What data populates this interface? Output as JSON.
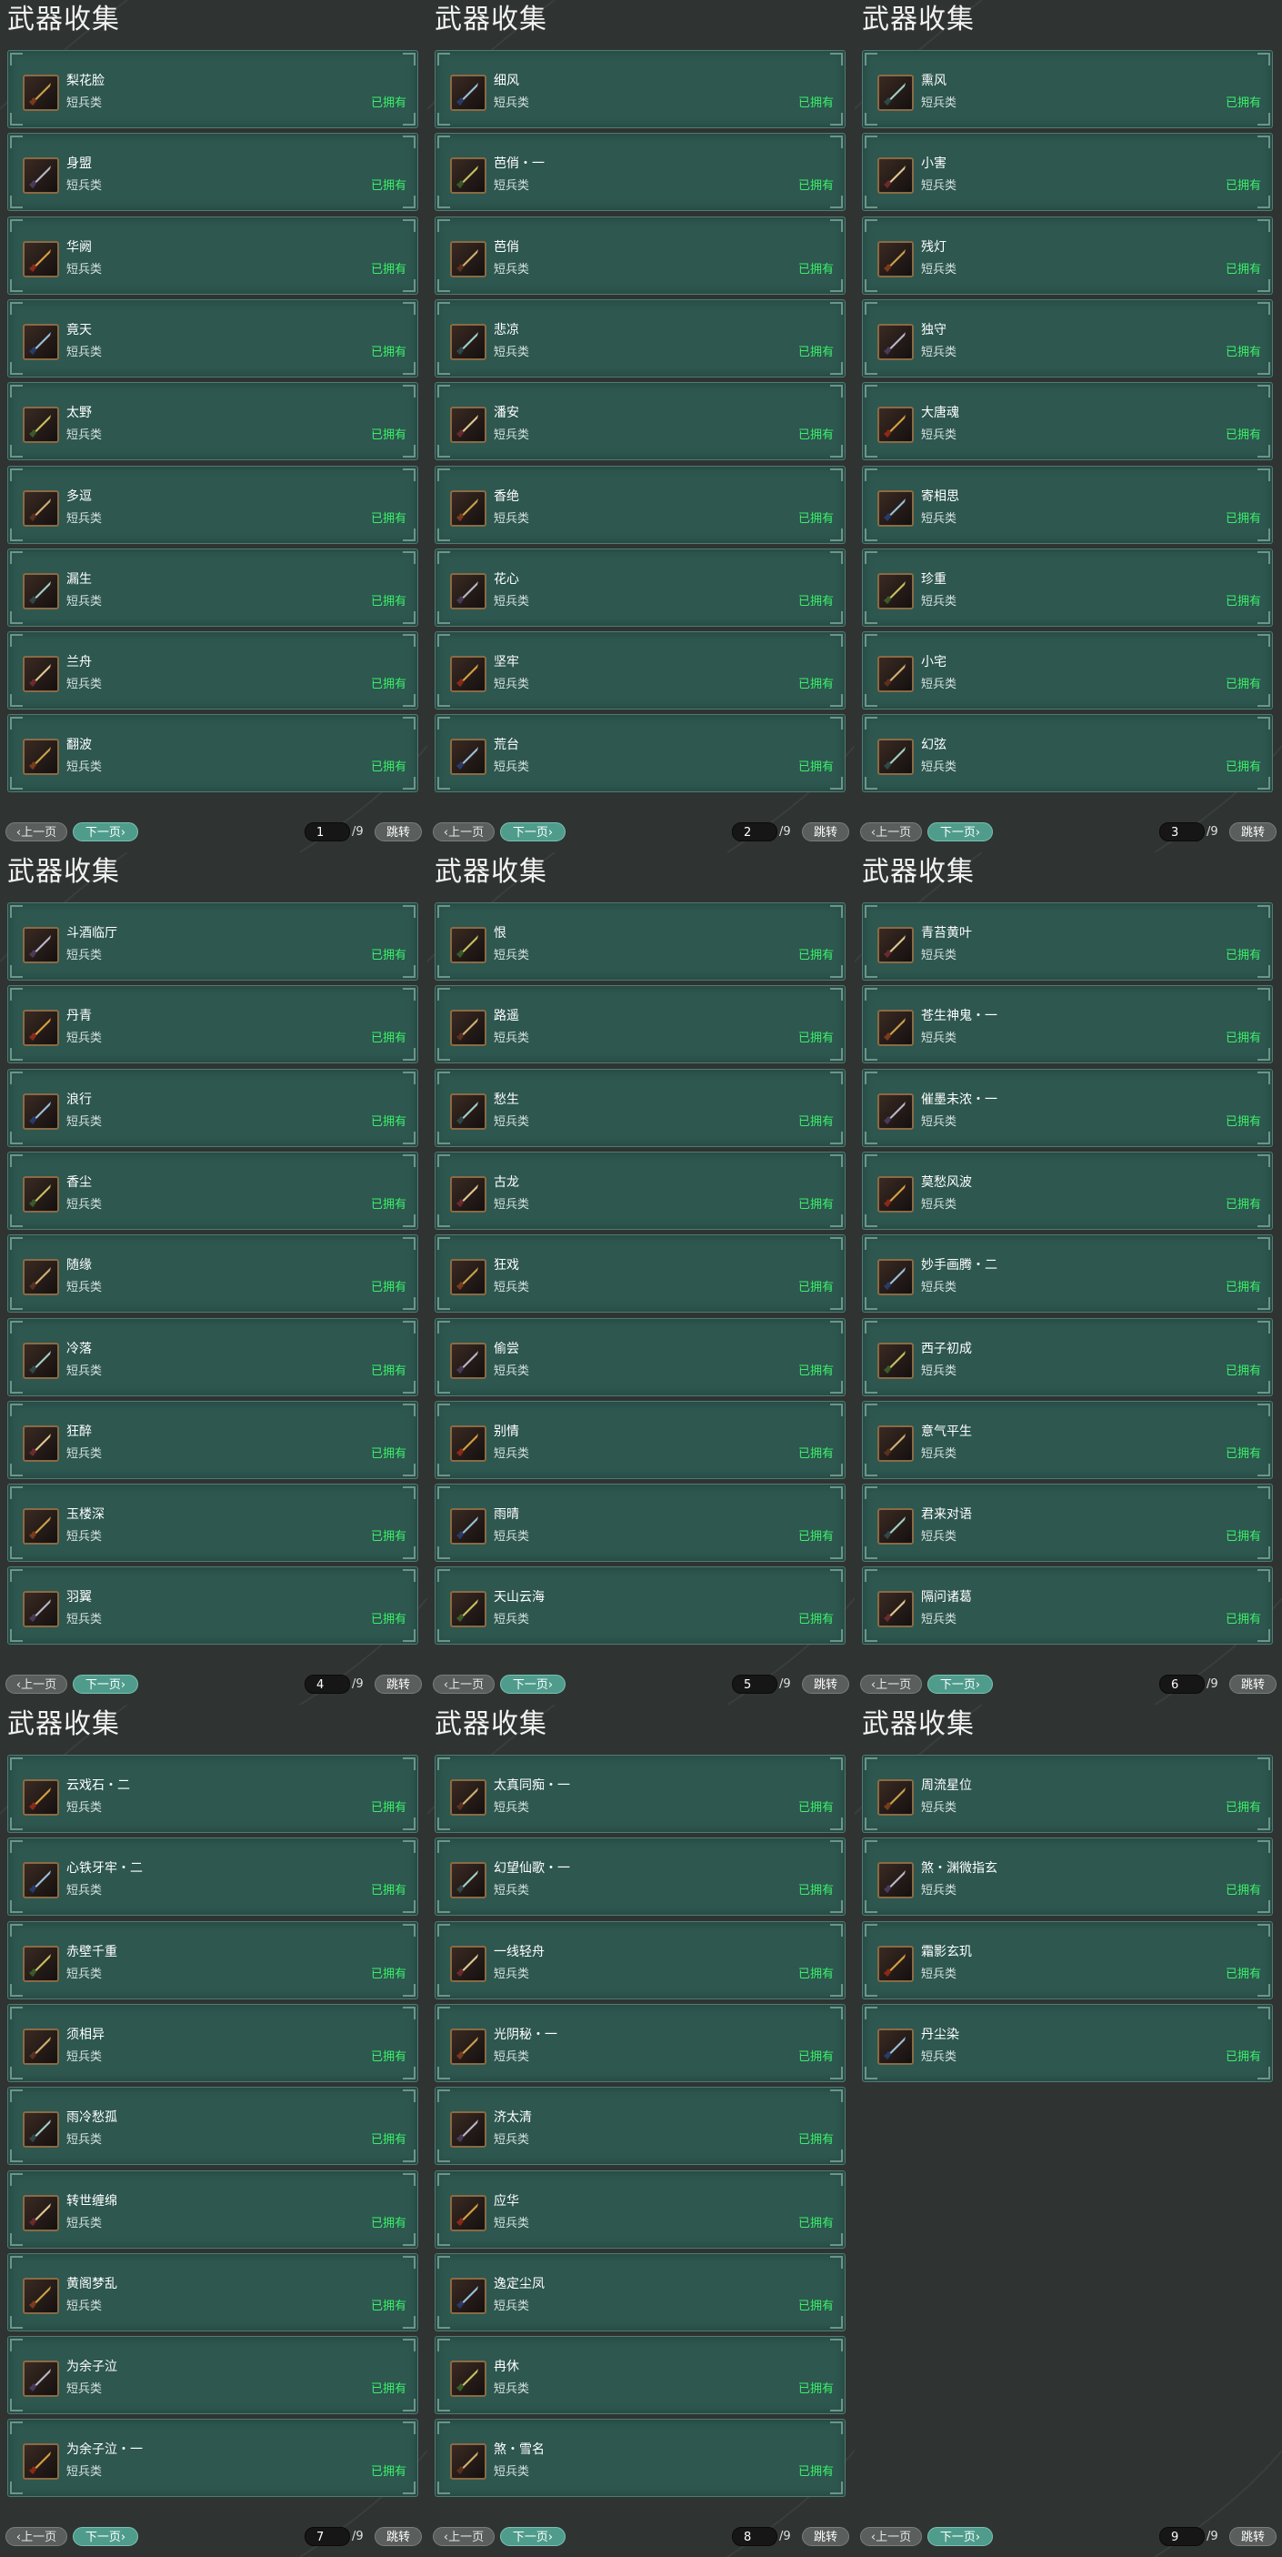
{
  "panels": [
    {
      "title": "武器收集",
      "page": "1",
      "total": "/9",
      "prev_label": "上一页",
      "next_label": "下一页",
      "jump_label": "跳转",
      "items": [
        {
          "name": "梨花脸",
          "type": "短兵类",
          "status": "已拥有"
        },
        {
          "name": "身盟",
          "type": "短兵类",
          "status": "已拥有"
        },
        {
          "name": "华阙",
          "type": "短兵类",
          "status": "已拥有"
        },
        {
          "name": "竟天",
          "type": "短兵类",
          "status": "已拥有"
        },
        {
          "name": "太野",
          "type": "短兵类",
          "status": "已拥有"
        },
        {
          "name": "多逗",
          "type": "短兵类",
          "status": "已拥有"
        },
        {
          "name": "漏生",
          "type": "短兵类",
          "status": "已拥有"
        },
        {
          "name": "兰舟",
          "type": "短兵类",
          "status": "已拥有"
        },
        {
          "name": "翻波",
          "type": "短兵类",
          "status": "已拥有"
        }
      ]
    },
    {
      "title": "武器收集",
      "page": "2",
      "total": "/9",
      "prev_label": "上一页",
      "next_label": "下一页",
      "jump_label": "跳转",
      "items": [
        {
          "name": "细风",
          "type": "短兵类",
          "status": "已拥有"
        },
        {
          "name": "芭俏・一",
          "type": "短兵类",
          "status": "已拥有"
        },
        {
          "name": "芭俏",
          "type": "短兵类",
          "status": "已拥有"
        },
        {
          "name": "悲凉",
          "type": "短兵类",
          "status": "已拥有"
        },
        {
          "name": "潘安",
          "type": "短兵类",
          "status": "已拥有"
        },
        {
          "name": "香绝",
          "type": "短兵类",
          "status": "已拥有"
        },
        {
          "name": "花心",
          "type": "短兵类",
          "status": "已拥有"
        },
        {
          "name": "坚牢",
          "type": "短兵类",
          "status": "已拥有"
        },
        {
          "name": "荒台",
          "type": "短兵类",
          "status": "已拥有"
        }
      ]
    },
    {
      "title": "武器收集",
      "page": "3",
      "total": "/9",
      "prev_label": "上一页",
      "next_label": "下一页",
      "jump_label": "跳转",
      "items": [
        {
          "name": "熏风",
          "type": "短兵类",
          "status": "已拥有"
        },
        {
          "name": "小害",
          "type": "短兵类",
          "status": "已拥有"
        },
        {
          "name": "残灯",
          "type": "短兵类",
          "status": "已拥有"
        },
        {
          "name": "独守",
          "type": "短兵类",
          "status": "已拥有"
        },
        {
          "name": "大唐魂",
          "type": "短兵类",
          "status": "已拥有"
        },
        {
          "name": "寄相思",
          "type": "短兵类",
          "status": "已拥有"
        },
        {
          "name": "珍重",
          "type": "短兵类",
          "status": "已拥有"
        },
        {
          "name": "小宅",
          "type": "短兵类",
          "status": "已拥有"
        },
        {
          "name": "幻弦",
          "type": "短兵类",
          "status": "已拥有"
        }
      ]
    },
    {
      "title": "武器收集",
      "page": "4",
      "total": "/9",
      "prev_label": "上一页",
      "next_label": "下一页",
      "jump_label": "跳转",
      "items": [
        {
          "name": "斗酒临厅",
          "type": "短兵类",
          "status": "已拥有"
        },
        {
          "name": "丹青",
          "type": "短兵类",
          "status": "已拥有"
        },
        {
          "name": "浪行",
          "type": "短兵类",
          "status": "已拥有"
        },
        {
          "name": "香尘",
          "type": "短兵类",
          "status": "已拥有"
        },
        {
          "name": "随缘",
          "type": "短兵类",
          "status": "已拥有"
        },
        {
          "name": "冷落",
          "type": "短兵类",
          "status": "已拥有"
        },
        {
          "name": "狂醉",
          "type": "短兵类",
          "status": "已拥有"
        },
        {
          "name": "玉楼深",
          "type": "短兵类",
          "status": "已拥有"
        },
        {
          "name": "羽翼",
          "type": "短兵类",
          "status": "已拥有"
        }
      ]
    },
    {
      "title": "武器收集",
      "page": "5",
      "total": "/9",
      "prev_label": "上一页",
      "next_label": "下一页",
      "jump_label": "跳转",
      "items": [
        {
          "name": "恨",
          "type": "短兵类",
          "status": "已拥有"
        },
        {
          "name": "路遥",
          "type": "短兵类",
          "status": "已拥有"
        },
        {
          "name": "愁生",
          "type": "短兵类",
          "status": "已拥有"
        },
        {
          "name": "古龙",
          "type": "短兵类",
          "status": "已拥有"
        },
        {
          "name": "狂戏",
          "type": "短兵类",
          "status": "已拥有"
        },
        {
          "name": "偷尝",
          "type": "短兵类",
          "status": "已拥有"
        },
        {
          "name": "别情",
          "type": "短兵类",
          "status": "已拥有"
        },
        {
          "name": "雨晴",
          "type": "短兵类",
          "status": "已拥有"
        },
        {
          "name": "天山云海",
          "type": "短兵类",
          "status": "已拥有"
        }
      ]
    },
    {
      "title": "武器收集",
      "page": "6",
      "total": "/9",
      "prev_label": "上一页",
      "next_label": "下一页",
      "jump_label": "跳转",
      "items": [
        {
          "name": "青苔黄叶",
          "type": "短兵类",
          "status": "已拥有"
        },
        {
          "name": "苍生神鬼・一",
          "type": "短兵类",
          "status": "已拥有"
        },
        {
          "name": "催墨未浓・一",
          "type": "短兵类",
          "status": "已拥有"
        },
        {
          "name": "莫愁风波",
          "type": "短兵类",
          "status": "已拥有"
        },
        {
          "name": "妙手画腾・二",
          "type": "短兵类",
          "status": "已拥有"
        },
        {
          "name": "西子初成",
          "type": "短兵类",
          "status": "已拥有"
        },
        {
          "name": "意气平生",
          "type": "短兵类",
          "status": "已拥有"
        },
        {
          "name": "君来对语",
          "type": "短兵类",
          "status": "已拥有"
        },
        {
          "name": "隔问诸葛",
          "type": "短兵类",
          "status": "已拥有"
        }
      ]
    },
    {
      "title": "武器收集",
      "page": "7",
      "total": "/9",
      "prev_label": "上一页",
      "next_label": "下一页",
      "jump_label": "跳转",
      "items": [
        {
          "name": "云戏石・二",
          "type": "短兵类",
          "status": "已拥有"
        },
        {
          "name": "心铁牙牢・二",
          "type": "短兵类",
          "status": "已拥有"
        },
        {
          "name": "赤壁千重",
          "type": "短兵类",
          "status": "已拥有"
        },
        {
          "name": "须相异",
          "type": "短兵类",
          "status": "已拥有"
        },
        {
          "name": "雨冷愁孤",
          "type": "短兵类",
          "status": "已拥有"
        },
        {
          "name": "转世缠绵",
          "type": "短兵类",
          "status": "已拥有"
        },
        {
          "name": "黄阁梦乱",
          "type": "短兵类",
          "status": "已拥有"
        },
        {
          "name": "为余子泣",
          "type": "短兵类",
          "status": "已拥有"
        },
        {
          "name": "为余子泣・一",
          "type": "短兵类",
          "status": "已拥有"
        }
      ]
    },
    {
      "title": "武器收集",
      "page": "8",
      "total": "/9",
      "prev_label": "上一页",
      "next_label": "下一页",
      "jump_label": "跳转",
      "items": [
        {
          "name": "太真同痴・一",
          "type": "短兵类",
          "status": "已拥有"
        },
        {
          "name": "幻望仙歌・一",
          "type": "短兵类",
          "status": "已拥有"
        },
        {
          "name": "一线轻舟",
          "type": "短兵类",
          "status": "已拥有"
        },
        {
          "name": "光阴秘・一",
          "type": "短兵类",
          "status": "已拥有"
        },
        {
          "name": "济太清",
          "type": "短兵类",
          "status": "已拥有"
        },
        {
          "name": "应华",
          "type": "短兵类",
          "status": "已拥有"
        },
        {
          "name": "逸定尘凤",
          "type": "短兵类",
          "status": "已拥有"
        },
        {
          "name": "冉休",
          "type": "短兵类",
          "status": "已拥有"
        },
        {
          "name": "煞・雪名",
          "type": "短兵类",
          "status": "已拥有"
        }
      ]
    },
    {
      "title": "武器收集",
      "page": "9",
      "total": "/9",
      "prev_label": "上一页",
      "next_label": "下一页",
      "jump_label": "跳转",
      "items": [
        {
          "name": "周流星位",
          "type": "短兵类",
          "status": "已拥有"
        },
        {
          "name": "煞・渊微指玄",
          "type": "短兵类",
          "status": "已拥有"
        },
        {
          "name": "霜影玄玑",
          "type": "短兵类",
          "status": "已拥有"
        },
        {
          "name": "丹尘染",
          "type": "短兵类",
          "status": "已拥有"
        }
      ]
    }
  ],
  "colors": {
    "card_bg": "#2d574f",
    "status_green": "#3cf06a",
    "next_btn": "#4f9c8c",
    "page_bg": "#2d302f"
  }
}
